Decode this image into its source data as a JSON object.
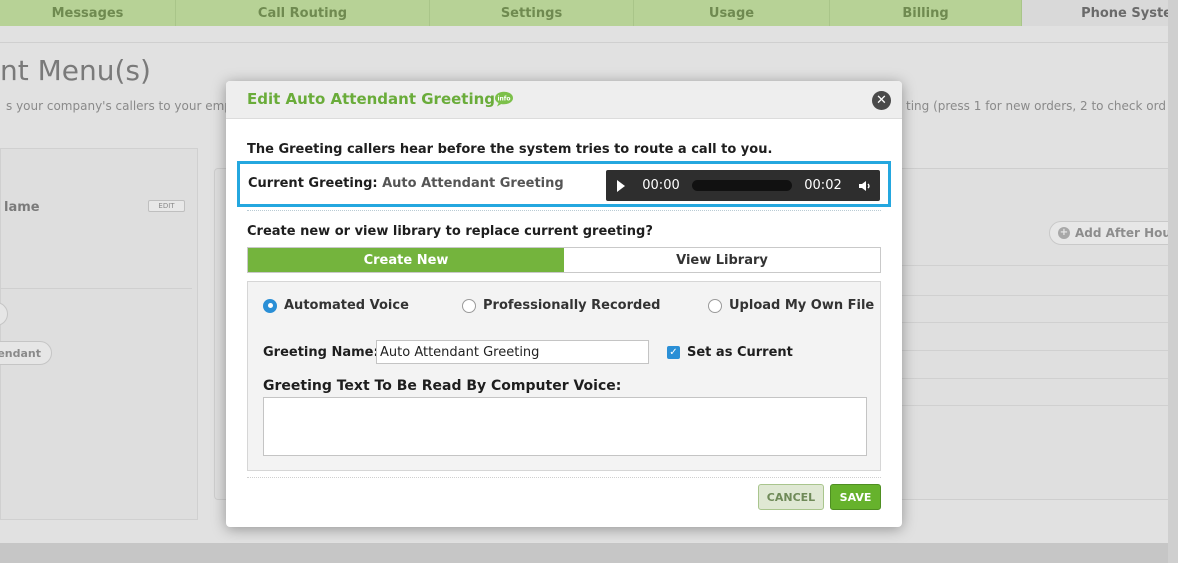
{
  "background": {
    "nav_tabs": [
      {
        "label": "Messages"
      },
      {
        "label": "Call Routing"
      },
      {
        "label": "Settings"
      },
      {
        "label": "Usage"
      },
      {
        "label": "Billing"
      },
      {
        "label": "Phone Syste"
      }
    ],
    "page_title": "nt Menu(s)",
    "description_left": "s your company's callers to your emp",
    "description_right": "ting (press 1 for new orders, 2 to check ord",
    "name_label": "lame",
    "edit_badge": "EDIT",
    "attendant_button": "endant",
    "add_after_hours": "Add After Hours"
  },
  "modal": {
    "title": "Edit Auto Attendant Greeting",
    "help_icon": "help-speech-bubble-icon",
    "intro_text": "The Greeting callers hear before the system tries to route a call to you.",
    "current_greeting_label": "Current Greeting:",
    "current_greeting_value": "Auto Attendant Greeting",
    "player": {
      "current_time": "00:00",
      "duration": "00:02",
      "progress": 0
    },
    "create_prompt": "Create new or view library to replace current greeting?",
    "tabs": [
      {
        "label": "Create New",
        "active": true
      },
      {
        "label": "View Library",
        "active": false
      }
    ],
    "radio_options": [
      {
        "label": "Automated Voice",
        "checked": true
      },
      {
        "label": "Professionally Recorded",
        "checked": false
      },
      {
        "label": "Upload My Own File",
        "checked": false
      }
    ],
    "greeting_name_label": "Greeting Name:",
    "greeting_name_value": "Auto Attendant Greeting",
    "set_as_current_label": "Set as Current",
    "set_as_current_checked": true,
    "greeting_text_label": "Greeting Text To Be Read By Computer Voice:",
    "greeting_text_value": "",
    "cancel_label": "CANCEL",
    "save_label": "SAVE"
  },
  "colors": {
    "accent_green": "#74b43d",
    "title_green": "#6aac3a",
    "highlight_blue": "#24a7df",
    "checkbox_blue": "#2a8fd6"
  }
}
